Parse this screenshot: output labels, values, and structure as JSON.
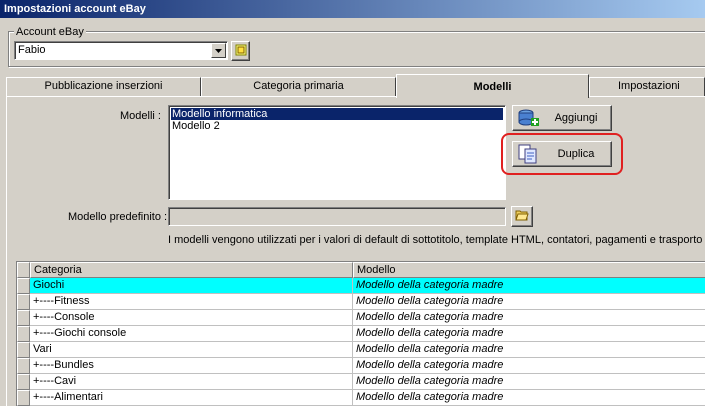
{
  "window": {
    "title": "Impostazioni account eBay"
  },
  "account": {
    "group_label": "Account eBay",
    "selected": "Fabio"
  },
  "tabs": [
    {
      "label": "Pubblicazione inserzioni",
      "active": false
    },
    {
      "label": "Categoria primaria",
      "active": false
    },
    {
      "label": "Modelli",
      "active": true
    },
    {
      "label": "Impostazioni",
      "active": false
    }
  ],
  "models": {
    "label": "Modelli :",
    "items": [
      "Modello informatica",
      "Modello 2"
    ],
    "selected_index": 0,
    "add_label": "Aggiungi",
    "duplicate_label": "Duplica"
  },
  "default_model": {
    "label": "Modello predefinito :",
    "value": "",
    "info": "I modelli vengono utilizzati per i valori di default di sottotitolo, template HTML, contatori, pagamenti e trasporto"
  },
  "grid": {
    "headers": [
      "Categoria",
      "Modello"
    ],
    "rows": [
      {
        "category": "Giochi",
        "model": "Modello della categoria madre",
        "selected": true
      },
      {
        "category": "+----Fitness",
        "model": "Modello della categoria madre",
        "selected": false
      },
      {
        "category": "+----Console",
        "model": "Modello della categoria madre",
        "selected": false
      },
      {
        "category": "+----Giochi console",
        "model": "Modello della categoria madre",
        "selected": false
      },
      {
        "category": "Vari",
        "model": "Modello della categoria madre",
        "selected": false
      },
      {
        "category": "+----Bundles",
        "model": "Modello della categoria madre",
        "selected": false
      },
      {
        "category": "+----Cavi",
        "model": "Modello della categoria madre",
        "selected": false
      },
      {
        "category": "+----Alimentari",
        "model": "Modello della categoria madre",
        "selected": false
      }
    ]
  },
  "colors": {
    "selection_row": "#00ffff",
    "list_selection": "#0a246a",
    "highlight_ring": "#e02020"
  },
  "icons": {
    "combo_arrow": "chevron-down-icon",
    "account_button": "edit-icon",
    "add": "database-add-icon",
    "duplicate": "copy-documents-icon",
    "browse": "folder-open-icon"
  }
}
